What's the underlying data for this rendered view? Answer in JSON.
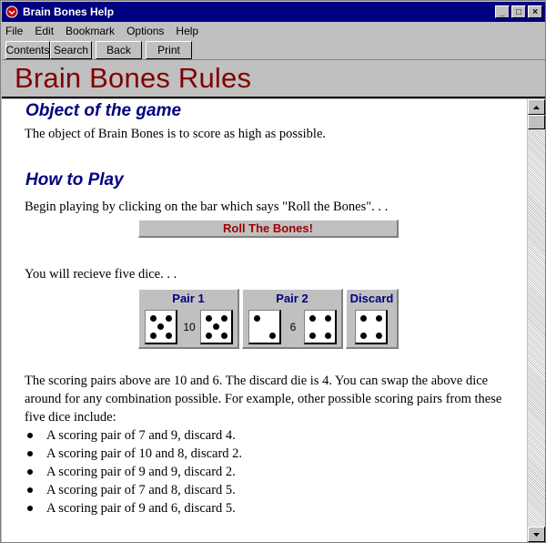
{
  "window": {
    "title": "Brain Bones Help",
    "controls": {
      "minimize": "_",
      "maximize": "□",
      "close": "×"
    }
  },
  "menu": [
    "File",
    "Edit",
    "Bookmark",
    "Options",
    "Help"
  ],
  "toolbar": [
    "Contents",
    "Search",
    "Back",
    "Print"
  ],
  "header": {
    "title": "Brain Bones Rules"
  },
  "sections": {
    "object": {
      "heading": "Object of the game",
      "text": "The object of Brain Bones is to score as high as possible."
    },
    "how_to_play": {
      "heading": "How to Play",
      "intro": "Begin playing by clicking on the bar which says \"Roll the Bones\". . .",
      "roll_button": "Roll The Bones!",
      "dice_intro": "You will recieve five dice. . .",
      "pair1": {
        "label": "Pair 1",
        "sum": "10",
        "dice": [
          5,
          5
        ]
      },
      "pair2": {
        "label": "Pair 2",
        "sum": "6",
        "dice": [
          2,
          4
        ]
      },
      "discard": {
        "label": "Discard",
        "dice": [
          4
        ]
      },
      "explanation": "The scoring pairs above are 10 and 6.  The discard die is 4.  You can swap the above dice around for any combination possible.  For example, other possible scoring pairs from these five dice include:",
      "examples": [
        "A scoring pair of 7 and 9, discard 4.",
        "A scoring pair of 10 and 8, discard 2.",
        "A scoring pair of 9 and 9, discard 2.",
        "A scoring pair of 7 and 8, discard 5.",
        "A scoring pair of 9 and 6, discard 5."
      ]
    }
  },
  "colors": {
    "title_bar": "#000080",
    "header_text": "#800000",
    "heading": "#000080",
    "roll_text": "#a00000"
  }
}
